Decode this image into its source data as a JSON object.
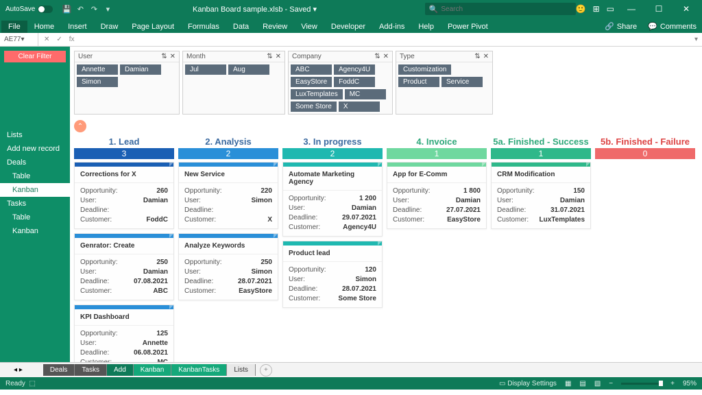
{
  "titlebar": {
    "autosave": "AutoSave",
    "filename": "Kanban Board sample.xlsb",
    "saved": "Saved",
    "search_placeholder": "Search"
  },
  "ribbon": {
    "tabs": [
      "File",
      "Home",
      "Insert",
      "Draw",
      "Page Layout",
      "Formulas",
      "Data",
      "Review",
      "View",
      "Developer",
      "Add-ins",
      "Help",
      "Power Pivot"
    ],
    "share": "Share",
    "comments": "Comments"
  },
  "formula": {
    "cell": "AE77",
    "fx": "fx"
  },
  "sidebar": {
    "clear": "Clear Filter",
    "items": [
      "Lists",
      "Add new record",
      "Deals",
      "Table",
      "Kanban",
      "Tasks",
      "Table",
      "Kanban"
    ],
    "active_index": 4,
    "indent": [
      0,
      0,
      0,
      1,
      1,
      0,
      1,
      1
    ]
  },
  "slicers": [
    {
      "cls": "user",
      "title": "User",
      "chips": [
        "Annette",
        "Damian",
        "Simon"
      ]
    },
    {
      "cls": "month",
      "title": "Month",
      "chips": [
        "Jul",
        "Aug"
      ]
    },
    {
      "cls": "company",
      "title": "Company",
      "chips": [
        "ABC",
        "Agency4U",
        "EasyStore",
        "FoddC",
        "LuxTemplates",
        "MC",
        "Some Store",
        "X"
      ]
    },
    {
      "cls": "type",
      "title": "Type",
      "chips": [
        "Customization",
        "Product",
        "Service"
      ]
    }
  ],
  "columns": [
    {
      "title": "1. Lead",
      "count": "3",
      "count_cls": "c-db",
      "hdr_cls": "",
      "cards": [
        {
          "top": "ct-db",
          "title": "Corrections for X",
          "opp": "260",
          "user": "Damian",
          "deadline": "",
          "cust": "FoddC"
        },
        {
          "top": "ct-b",
          "title": "Genrator: Create",
          "opp": "250",
          "user": "Damian",
          "deadline": "07.08.2021",
          "cust": "ABC"
        },
        {
          "top": "ct-b",
          "title": "KPI Dashboard",
          "opp": "125",
          "user": "Annette",
          "deadline": "06.08.2021",
          "cust": "MC"
        }
      ]
    },
    {
      "title": "2. Analysis",
      "count": "2",
      "count_cls": "c-b",
      "hdr_cls": "",
      "cards": [
        {
          "top": "ct-b",
          "title": "New Service",
          "opp": "220",
          "user": "Simon",
          "deadline": "",
          "cust": "X"
        },
        {
          "top": "ct-b",
          "title": "Analyze Keywords",
          "opp": "250",
          "user": "Simon",
          "deadline": "28.07.2021",
          "cust": "EasyStore"
        }
      ]
    },
    {
      "title": "3. In progress",
      "count": "2",
      "count_cls": "c-t",
      "hdr_cls": "",
      "cards": [
        {
          "top": "ct-t",
          "title": "Automate Marketing Agency",
          "opp": "1 200",
          "user": "Damian",
          "deadline": "29.07.2021",
          "cust": "Agency4U"
        },
        {
          "top": "ct-t",
          "title": "Product lead",
          "opp": "120",
          "user": "Simon",
          "deadline": "28.07.2021",
          "cust": "Some Store"
        }
      ]
    },
    {
      "title": "4. Invoice",
      "count": "1",
      "count_cls": "c-lg",
      "hdr_cls": "green",
      "cards": [
        {
          "top": "ct-lg",
          "title": "App for E-Comm",
          "opp": "1 800",
          "user": "Damian",
          "deadline": "27.07.2021",
          "cust": "EasyStore"
        }
      ]
    },
    {
      "title": "5a. Finished - Success",
      "count": "1",
      "count_cls": "c-g",
      "hdr_cls": "green",
      "cards": [
        {
          "top": "ct-g",
          "title": "CRM Modification",
          "opp": "150",
          "user": "Damian",
          "deadline": "31.07.2021",
          "cust": "LuxTemplates"
        }
      ]
    },
    {
      "title": "5b. Finished - Failure",
      "count": "0",
      "count_cls": "c-r",
      "hdr_cls": "red",
      "cards": []
    }
  ],
  "labels": {
    "opp": "Opportunity:",
    "user": "User:",
    "deadline": "Deadline:",
    "cust": "Customer:"
  },
  "sheets": {
    "tabs": [
      {
        "n": "Deals",
        "c": ""
      },
      {
        "n": "Tasks",
        "c": ""
      },
      {
        "n": "Add",
        "c": "g1"
      },
      {
        "n": "Kanban",
        "c": "g2"
      },
      {
        "n": "KanbanTasks",
        "c": "g2"
      },
      {
        "n": "Lists",
        "c": "lt"
      }
    ]
  },
  "status": {
    "ready": "Ready",
    "display": "Display Settings",
    "zoom": "95%"
  }
}
